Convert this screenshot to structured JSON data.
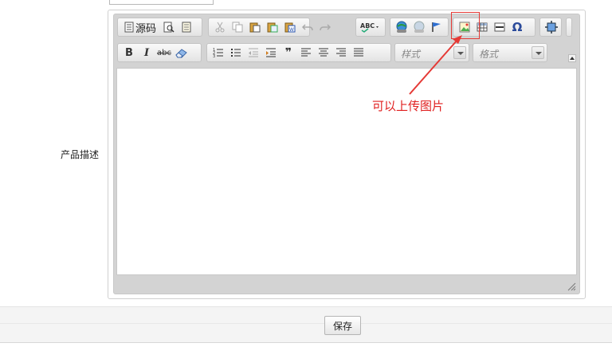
{
  "form": {
    "top_label": "",
    "top_input_value": "",
    "description_label": "产品描述",
    "save_label": "保存"
  },
  "editor": {
    "toolbar": {
      "source_label": "源码",
      "style_placeholder": "样式",
      "format_placeholder": "格式",
      "bold_label": "B",
      "italic_label": "I",
      "strike_label": "abc",
      "blockquote_label": "❞",
      "special_char_label": "Ω"
    },
    "content": ""
  },
  "annotation": {
    "text": "可以上传图片",
    "color": "#e02020"
  },
  "colors": {
    "toolbar_bg": "#e3e3e3",
    "editor_frame": "#d3d3d3",
    "annotation_red": "#e53935"
  }
}
